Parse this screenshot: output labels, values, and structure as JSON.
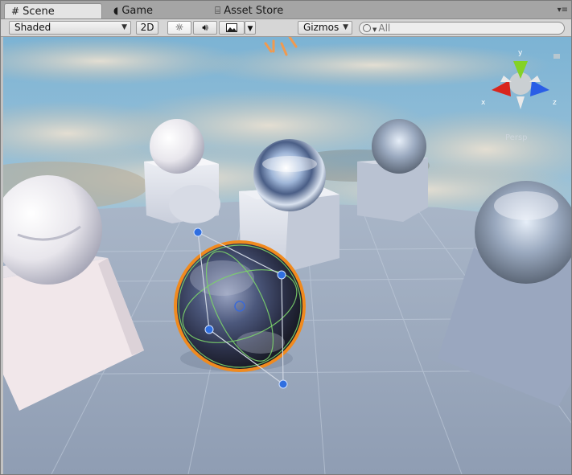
{
  "tabs": [
    {
      "label": "Scene",
      "icon": "grid-icon",
      "active": true
    },
    {
      "label": "Game",
      "icon": "game-pacman-icon",
      "active": false
    },
    {
      "label": "Asset Store",
      "icon": "shopping-bag-icon",
      "active": false
    }
  ],
  "toolbar": {
    "draw_mode": "Shaded",
    "mode_2d": "2D",
    "lighting_icon": "sun-icon",
    "audio_icon": "speaker-icon",
    "effects_icon": "image-icon",
    "gizmos": "Gizmos",
    "search_placeholder": "All"
  },
  "scene_gizmo": {
    "x_label": "x",
    "y_label": "y",
    "z_label": "z",
    "x_color": "#d9251c",
    "y_color": "#84d226",
    "z_color": "#2a5ee6",
    "projection": "Persp"
  },
  "selection": {
    "object": "globe-sphere",
    "outline_color": "#f08a1e"
  }
}
